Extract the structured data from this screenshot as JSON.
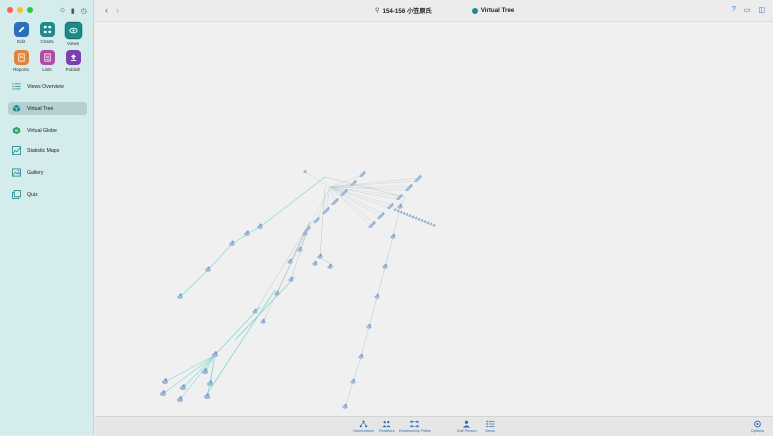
{
  "sidebar": {
    "modes": [
      {
        "label": "Edit",
        "icon": "pencil-icon"
      },
      {
        "label": "Charts",
        "icon": "charts-icon"
      },
      {
        "label": "Views",
        "icon": "eye-icon"
      },
      {
        "label": "Reports",
        "icon": "reports-icon"
      },
      {
        "label": "Lists",
        "icon": "lists-icon"
      },
      {
        "label": "Publish",
        "icon": "publish-icon"
      }
    ],
    "nav": [
      {
        "label": "Views Overview",
        "icon": "list-icon"
      },
      {
        "label": "Virtual Tree",
        "icon": "cube-icon",
        "active": true
      },
      {
        "label": "Virtual Globe",
        "icon": "globe-icon"
      },
      {
        "label": "Statistic Maps",
        "icon": "map-icon"
      },
      {
        "label": "Gallery",
        "icon": "gallery-icon"
      },
      {
        "label": "Quiz",
        "icon": "quiz-icon"
      }
    ]
  },
  "topbar": {
    "person": "154-156 小笠原氏",
    "view": "Virtual Tree"
  },
  "bottombar": {
    "items": [
      {
        "label": "Generations",
        "icon": "generations-icon"
      },
      {
        "label": "Relatives",
        "icon": "relatives-icon"
      },
      {
        "label": "Relationship Paths",
        "icon": "relationship-paths-icon"
      },
      {
        "label": "Edit Person",
        "icon": "edit-person-icon"
      },
      {
        "label": "Views",
        "icon": "views-icon"
      },
      {
        "label": "Options",
        "icon": "options-icon"
      }
    ]
  },
  "colors": {
    "accent": "#1f8a8c",
    "sidebar_bg": "#d4ecec",
    "link_blue": "#2c6fb8"
  }
}
